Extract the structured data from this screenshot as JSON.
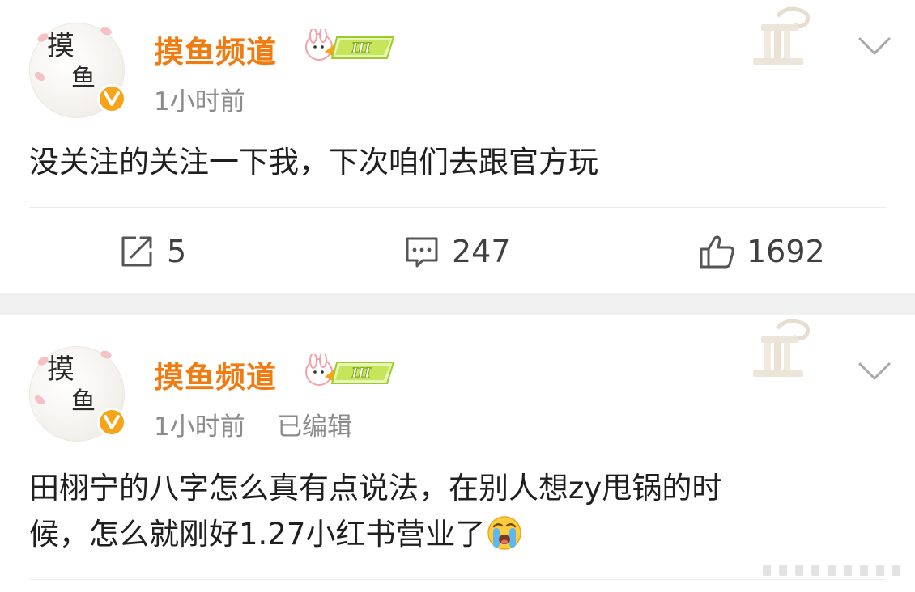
{
  "posts": [
    {
      "username": "摸鱼频道",
      "member_level": "III",
      "timestamp": "1小时前",
      "edited": "",
      "text": "没关注的关注一下我，下次咱们去跟官方玩",
      "actions": {
        "repost": "5",
        "comment": "247",
        "like": "1692"
      }
    },
    {
      "username": "摸鱼频道",
      "member_level": "III",
      "timestamp": "1小时前",
      "edited": "已编辑",
      "text_line1": "田栩宁的八字怎么真有点说法，在别人想zy甩锅的时",
      "text_line2": "候，怎么就刚好1.27小红书营业了"
    }
  ],
  "avatar_text": {
    "char1": "摸",
    "char2": "鱼"
  },
  "icons": {
    "verified": "verified-v-badge-icon",
    "chevron": "chevron-down-icon",
    "repost": "repost-icon",
    "comment": "comment-icon",
    "like": "thumbs-up-icon",
    "emoji": "crying-face-emoji"
  },
  "colors": {
    "username": "#f07b10",
    "verified": "#f7a418",
    "muted": "#8b8b8b",
    "separator": "#f1f1f1"
  }
}
